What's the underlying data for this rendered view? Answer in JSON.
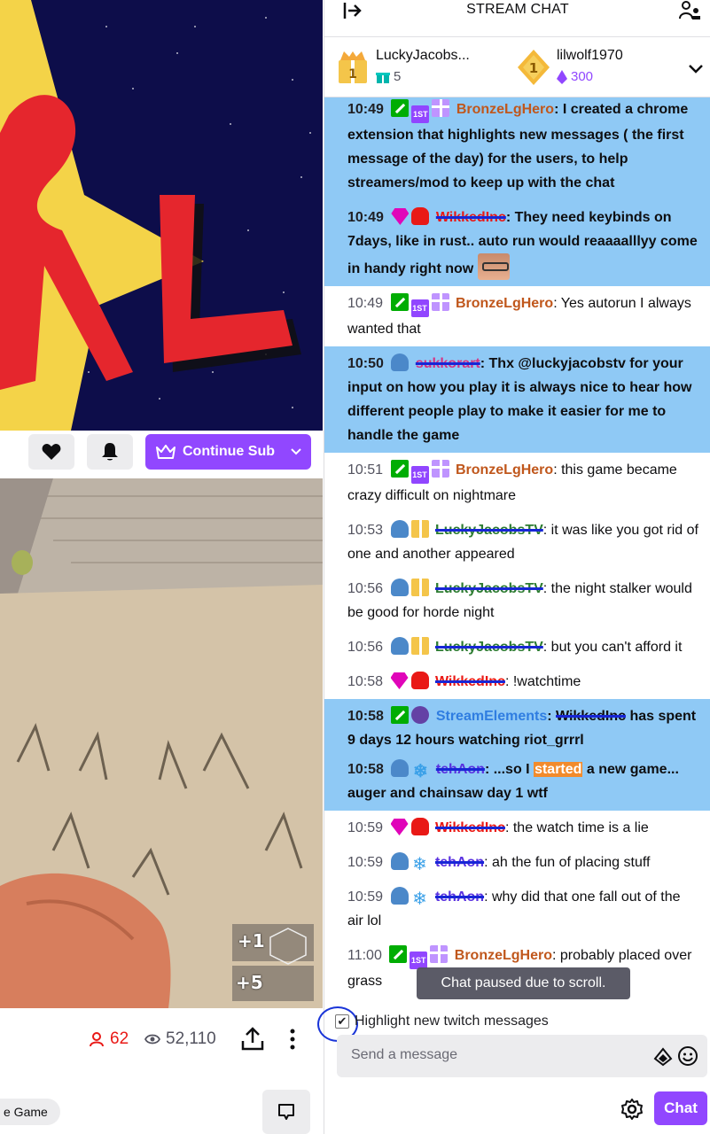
{
  "channel": {
    "banner_text": "RL",
    "actions": {
      "follow_icon": "heart-icon",
      "notify_icon": "bell-icon",
      "sub_label": "Continue Sub"
    },
    "video_hud": {
      "top": "+1",
      "bottom": "+5"
    },
    "stats": {
      "viewers": "62",
      "views": "52,110"
    },
    "category_tag": "e Game"
  },
  "chat": {
    "title": "STREAM CHAT",
    "gifters": [
      {
        "name": "LuckyJacobs...",
        "count": "5"
      },
      {
        "name": "lilwolf1970",
        "count": "300"
      }
    ],
    "messages": [
      {
        "time": "10:49",
        "user": "BronzeLgHero",
        "sep": ": ",
        "text": "I created a chrome extension that highlights new messages ( the first message of the day) for the users, to help streamers/mod to keep up with the chat"
      },
      {
        "time": "10:49",
        "user": "WikkedInc",
        "sep": ": ",
        "text": "They need keybinds on 7days, like in rust.. auto run would reaaaalllyy come in handy right now"
      },
      {
        "time": "10:49",
        "user": "BronzeLgHero",
        "sep": ": ",
        "text": "Yes autorun I always wanted that"
      },
      {
        "time": "10:50",
        "user": "sukkorart",
        "sep": ": ",
        "text": "Thx @luckyjacobstv for your input on how you play it is always nice to hear how different people play to make it easier for me to handle the game"
      },
      {
        "time": "10:51",
        "user": "BronzeLgHero",
        "sep": ": ",
        "text": "this game became crazy difficult on nightmare"
      },
      {
        "time": "10:53",
        "user": "LuckyJacobsTV",
        "sep": ": ",
        "text": "it was like you got rid of one and another appeared"
      },
      {
        "time": "10:56",
        "user": "LuckyJacobsTV",
        "sep": ": ",
        "text": "the night stalker would be good for horde night"
      },
      {
        "time": "10:56",
        "user": "LuckyJacobsTV",
        "sep": ": ",
        "text": "but you can't afford it"
      },
      {
        "time": "10:58",
        "user": "WikkedInc",
        "sep": ": ",
        "text": "!watchtime"
      },
      {
        "time": "10:58",
        "user": "StreamElements",
        "sep": ": ",
        "redacted": "WikkedInc",
        "text": " has spent 9 days 12 hours watching riot_grrrl"
      },
      {
        "time": "10:58",
        "user": "tehAon",
        "sep": ": ",
        "pre": "...so I ",
        "mark": "started",
        "text": " a new game... auger and chainsaw day 1 wtf"
      },
      {
        "time": "10:59",
        "user": "WikkedInc",
        "sep": ": ",
        "text": "the watch time is a lie"
      },
      {
        "time": "10:59",
        "user": "tehAon",
        "sep": ": ",
        "text": "ah the fun of placing stuff"
      },
      {
        "time": "10:59",
        "user": "tehAon",
        "sep": ": ",
        "text": "why did that one fall out of the air lol"
      },
      {
        "time": "11:00",
        "user": "BronzeLgHero",
        "sep": ": ",
        "text": "probably placed over grass"
      }
    ],
    "paused_notice": "Chat paused due to scroll.",
    "highlight_label": "Highlight new twitch messages",
    "highlight_checked": "✔",
    "input_placeholder": "Send a message",
    "send_label": "Chat"
  },
  "colors": {
    "accent": "#9147ff",
    "highlight_bg": "#8fc9f5",
    "bronze": "#c0571c",
    "wikked": "#e91916",
    "tehaon": "#5a31e0",
    "lucky": "#2e7d32",
    "sukko": "#d63384",
    "streamelements": "#2f7de1"
  }
}
